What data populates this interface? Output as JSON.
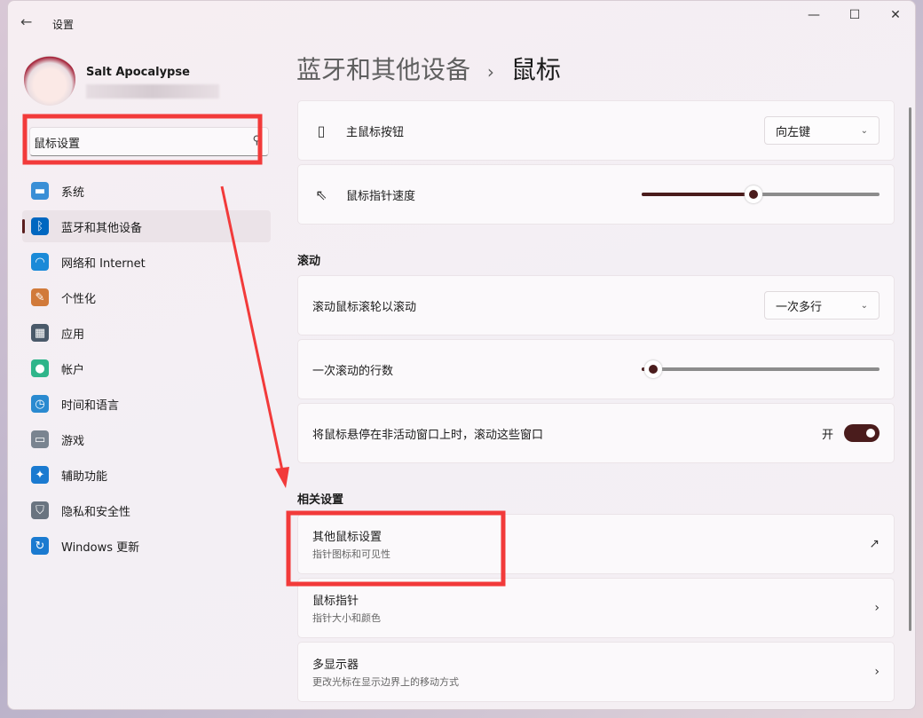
{
  "window": {
    "title": "设置",
    "back_icon": "arrow-left-icon",
    "minimize": "—",
    "maximize": "☐",
    "close": "✕"
  },
  "user": {
    "name": "Salt Apocalypse"
  },
  "search": {
    "value": "鼠标设置",
    "icon": "search-icon"
  },
  "sidebar": {
    "items": [
      {
        "label": "系统",
        "icon": "monitor-icon",
        "color": "#3a8fd6"
      },
      {
        "label": "蓝牙和其他设备",
        "icon": "bluetooth-icon",
        "color": "#0067c0",
        "active": true
      },
      {
        "label": "网络和 Internet",
        "icon": "wifi-icon",
        "color": "#1a8ad8"
      },
      {
        "label": "个性化",
        "icon": "brush-icon",
        "color": "#d17a3a"
      },
      {
        "label": "应用",
        "icon": "apps-icon",
        "color": "#4a5a6a"
      },
      {
        "label": "帐户",
        "icon": "person-icon",
        "color": "#2fb58a"
      },
      {
        "label": "时间和语言",
        "icon": "clock-globe-icon",
        "color": "#2a8ad0"
      },
      {
        "label": "游戏",
        "icon": "gamepad-icon",
        "color": "#7a8490"
      },
      {
        "label": "辅助功能",
        "icon": "accessibility-icon",
        "color": "#1a7ad0"
      },
      {
        "label": "隐私和安全性",
        "icon": "shield-icon",
        "color": "#6a7480"
      },
      {
        "label": "Windows 更新",
        "icon": "update-icon",
        "color": "#1a7ad0"
      }
    ]
  },
  "breadcrumb": {
    "parent": "蓝牙和其他设备",
    "separator": "›",
    "current": "鼠标"
  },
  "settings": {
    "primary_button": {
      "label": "主鼠标按钮",
      "value": "向左键"
    },
    "pointer_speed": {
      "label": "鼠标指针速度",
      "percent": 47
    },
    "scroll_section": "滚动",
    "scroll_wheel": {
      "label": "滚动鼠标滚轮以滚动",
      "value": "一次多行"
    },
    "lines_to_scroll": {
      "label": "一次滚动的行数",
      "percent": 5
    },
    "inactive_scroll": {
      "label": "将鼠标悬停在非活动窗口上时，滚动这些窗口",
      "state": "开",
      "on": true
    },
    "related_section": "相关设置",
    "related": [
      {
        "title": "其他鼠标设置",
        "subtitle": "指针图标和可见性",
        "icon": "external-link-icon"
      },
      {
        "title": "鼠标指针",
        "subtitle": "指针大小和颜色",
        "icon": "chevron-right-icon"
      },
      {
        "title": "多显示器",
        "subtitle": "更改光标在显示边界上的移动方式",
        "icon": "chevron-right-icon"
      }
    ]
  },
  "colors": {
    "accent": "#4a1c1c",
    "annotation": "#f23a3a"
  }
}
